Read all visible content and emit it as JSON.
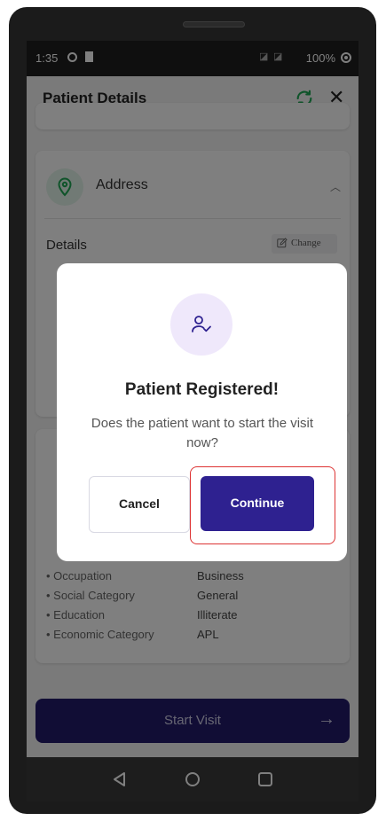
{
  "status_bar": {
    "time": "1:35",
    "battery": "100%"
  },
  "app_bar": {
    "title": "Patient Details"
  },
  "address_card": {
    "label": "Address",
    "details_label": "Details",
    "change_label": "Change"
  },
  "info_rows": [
    {
      "key": "• Occupation",
      "value": "Business"
    },
    {
      "key": "• Social Category",
      "value": "General"
    },
    {
      "key": "• Education",
      "value": "Illiterate"
    },
    {
      "key": "• Economic Category",
      "value": "APL"
    }
  ],
  "start_visit": {
    "label": "Start Visit",
    "arrow": "→"
  },
  "dialog": {
    "title": "Patient Registered!",
    "message": "Does the patient want to start the visit now?",
    "cancel_label": "Cancel",
    "continue_label": "Continue"
  },
  "colors": {
    "primary": "#2e2190",
    "accent_green": "#1fa855",
    "icon_bg": "#efe8fb",
    "highlight": "#dd3333"
  }
}
